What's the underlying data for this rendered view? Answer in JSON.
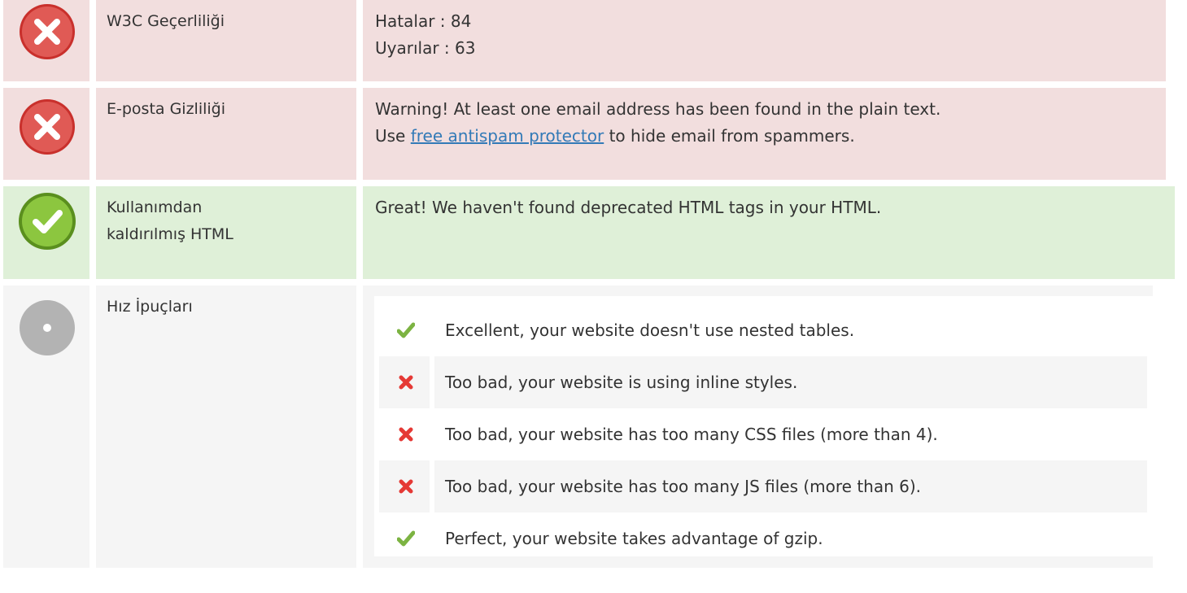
{
  "rows": {
    "w3c": {
      "status": "error",
      "label": "W3C Geçerliliği",
      "errors_line": "Hatalar : 84",
      "warnings_line": "Uyarılar : 63"
    },
    "email": {
      "status": "error",
      "label": "E-posta Gizliliği",
      "line1": "Warning! At least one email address has been found in the plain text.",
      "line2_prefix": "Use ",
      "line2_link": "free antispam protector",
      "line2_suffix": " to hide email from spammers."
    },
    "deprecated": {
      "status": "ok",
      "label_line1": "Kullanımdan",
      "label_line2": "kaldırılmış HTML",
      "text": "Great! We haven't found deprecated HTML tags in your HTML."
    },
    "speed": {
      "status": "neutral",
      "label": "Hız İpuçları",
      "tips": [
        {
          "status": "pass",
          "text": "Excellent, your website doesn't use nested tables."
        },
        {
          "status": "fail",
          "text": "Too bad, your website is using inline styles."
        },
        {
          "status": "fail",
          "text": "Too bad, your website has too many CSS files (more than 4)."
        },
        {
          "status": "fail",
          "text": "Too bad, your website has too many JS files (more than 6)."
        },
        {
          "status": "pass",
          "text": "Perfect, your website takes advantage of gzip."
        }
      ]
    }
  },
  "colors": {
    "error_bg": "#f2dede",
    "ok_bg": "#dff0d8",
    "neutral_bg": "#f5f5f5",
    "error_icon": "#d9534f",
    "ok_icon": "#7cb342",
    "link": "#337ab7",
    "check": "#7cb342",
    "cross": "#e53935"
  }
}
